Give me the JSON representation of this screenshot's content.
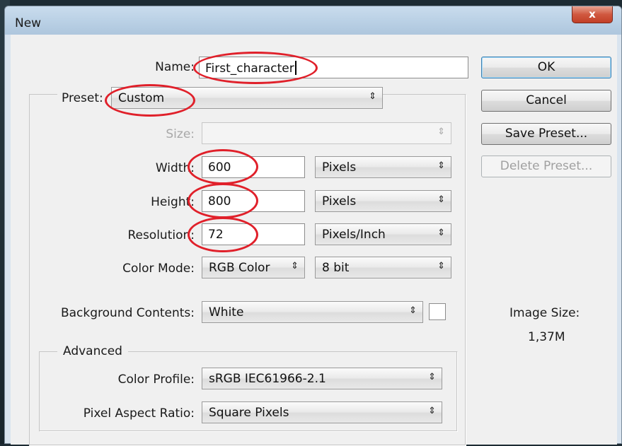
{
  "window": {
    "title": "New",
    "close_glyph": "x"
  },
  "form": {
    "name_label": "Name:",
    "name_value": "First_character",
    "preset_label": "Preset:",
    "preset_value": "Custom",
    "size_label": "Size:",
    "size_value": "",
    "width_label": "Width:",
    "width_value": "600",
    "width_unit": "Pixels",
    "height_label": "Height:",
    "height_value": "800",
    "height_unit": "Pixels",
    "resolution_label": "Resolution:",
    "resolution_value": "72",
    "resolution_unit": "Pixels/Inch",
    "color_mode_label": "Color Mode:",
    "color_mode_value": "RGB Color",
    "bit_depth_value": "8 bit",
    "background_label": "Background Contents:",
    "background_value": "White"
  },
  "advanced": {
    "legend": "Advanced",
    "color_profile_label": "Color Profile:",
    "color_profile_value": "sRGB IEC61966-2.1",
    "pixel_aspect_label": "Pixel Aspect Ratio:",
    "pixel_aspect_value": "Square Pixels"
  },
  "buttons": {
    "ok": "OK",
    "cancel": "Cancel",
    "save_preset": "Save Preset...",
    "delete_preset": "Delete Preset..."
  },
  "info": {
    "image_size_label": "Image Size:",
    "image_size_value": "1,37M"
  },
  "icons": {
    "dropdown_arrow": "⇕",
    "close": "close-icon"
  },
  "colors": {
    "annotation_ring": "#e0202a",
    "default_button_border": "#3c7fb1"
  }
}
